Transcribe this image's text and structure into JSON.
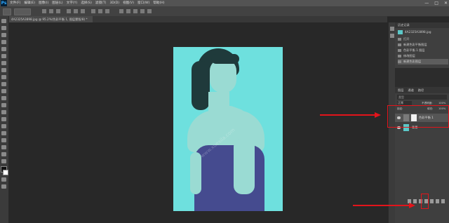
{
  "menubar": {
    "logo": "Ps",
    "items": [
      "文件(F)",
      "编辑(E)",
      "图像(I)",
      "图层(L)",
      "文字(Y)",
      "选择(S)",
      "滤镜(T)",
      "3D(D)",
      "视图(V)",
      "窗口(W)",
      "帮助(H)"
    ],
    "window_controls": [
      "—",
      "□",
      "✕"
    ]
  },
  "tab": {
    "title": "4A2325A3898.jpg @ 95.2%(色彩平衡 1, 图层蒙版/8) *"
  },
  "history_panel": {
    "title": "历史记录",
    "snapshot_label": "4A2325A3898.jpg",
    "items": [
      "打开",
      "新建色彩平衡图层",
      "色彩平衡 1 图层",
      "修改图层",
      "新建色彩图层"
    ],
    "active_index": 4
  },
  "layers_panel": {
    "tabs": [
      "图层",
      "通道",
      "路径"
    ],
    "filter_label": "类型",
    "mode_label": "正常",
    "opacity_label": "不透明度:",
    "opacity_value": "100%",
    "lock_label": "锁定:",
    "fill_label": "填充:",
    "fill_value": "100%",
    "layers": [
      {
        "name": "色彩平衡 1",
        "type": "adjustment"
      },
      {
        "name": "背景",
        "type": "background"
      }
    ]
  },
  "canvas": {
    "watermark": "www.xuexila.com"
  },
  "colors": {
    "annotation_red": "#e3141b",
    "photo_tint": "#6ee0de"
  }
}
